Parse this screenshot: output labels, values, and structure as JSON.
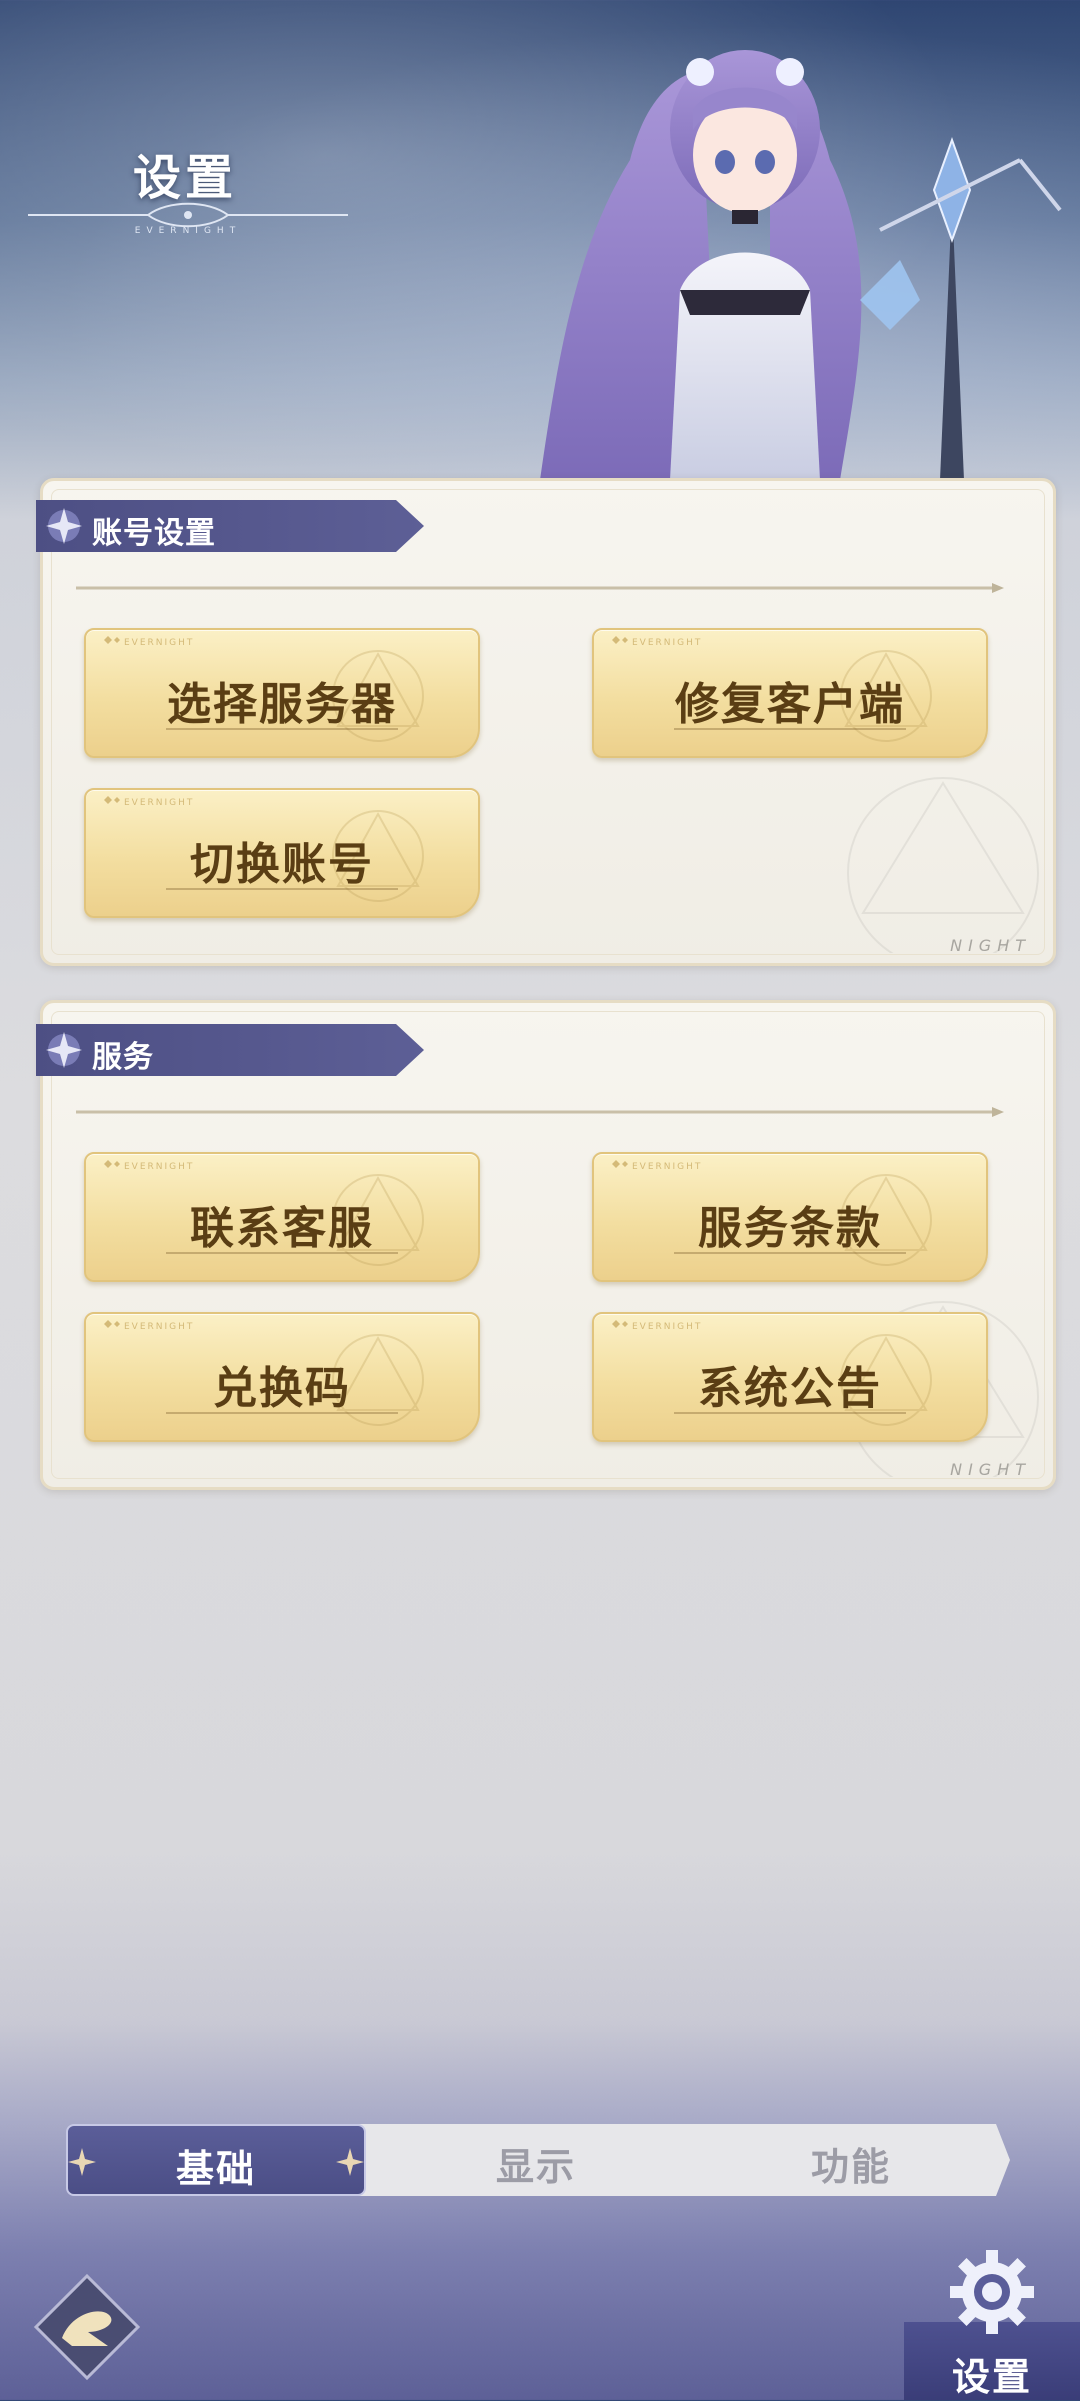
{
  "header": {
    "title": "设置",
    "ornament_text": "EVERNIGHT"
  },
  "colors": {
    "accent": "#5b5e99",
    "button_text": "#5a3e14",
    "button_gold": "#f3dea0"
  },
  "sections": {
    "account": {
      "title": "账号设置",
      "buttons": {
        "select_server": "选择服务器",
        "repair_client": "修复客户端",
        "switch_account": "切换账号"
      },
      "watermark": "NIGHT"
    },
    "service": {
      "title": "服务",
      "buttons": {
        "contact_support": "联系客服",
        "terms_of_service": "服务条款",
        "redeem_code": "兑换码",
        "system_notice": "系统公告"
      },
      "watermark": "NIGHT"
    }
  },
  "button_deco_text": "EVERNIGHT",
  "tabs": [
    {
      "label": "基础",
      "active": true
    },
    {
      "label": "显示",
      "active": false
    },
    {
      "label": "功能",
      "active": false
    }
  ],
  "bottom_nav": {
    "settings_label": "设置",
    "settings_icon": "gear-icon",
    "home_icon": "game-logo-icon"
  }
}
